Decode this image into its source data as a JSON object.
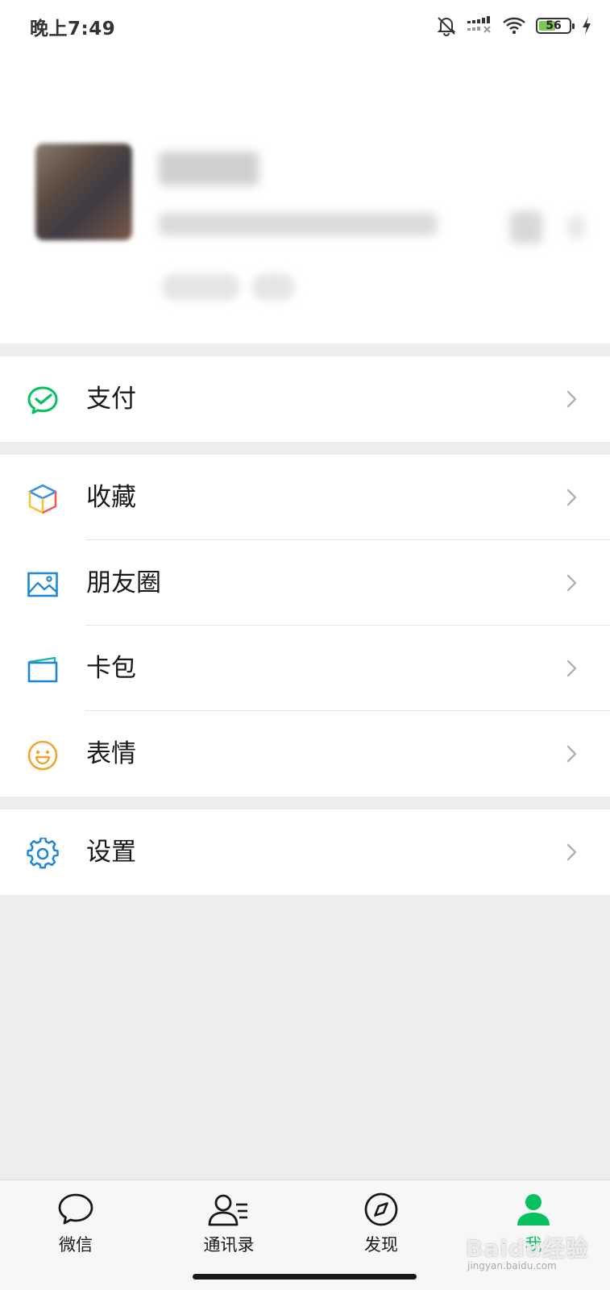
{
  "status_bar": {
    "time": "晚上7:49",
    "battery_level": 56,
    "battery_text": "56",
    "icons": [
      "bell-muted-icon",
      "signal-icon",
      "wifi-icon",
      "battery-icon",
      "charging-icon"
    ]
  },
  "menu": {
    "pay": {
      "label": "支付",
      "icon": "wechat-pay-icon"
    },
    "favorites": {
      "label": "收藏",
      "icon": "cube-icon"
    },
    "moments": {
      "label": "朋友圈",
      "icon": "picture-icon"
    },
    "cards": {
      "label": "卡包",
      "icon": "wallet-icon"
    },
    "stickers": {
      "label": "表情",
      "icon": "smile-icon"
    },
    "settings": {
      "label": "设置",
      "icon": "gear-icon"
    }
  },
  "tabbar": {
    "chats": "微信",
    "contacts": "通讯录",
    "discover": "发现",
    "me": "我",
    "active": "me"
  },
  "watermark": {
    "text": "Baidu经验",
    "sub": "jingyan.baidu.com"
  },
  "colors": {
    "accent_green": "#07c160",
    "background": "#ededed",
    "card": "#ffffff"
  }
}
